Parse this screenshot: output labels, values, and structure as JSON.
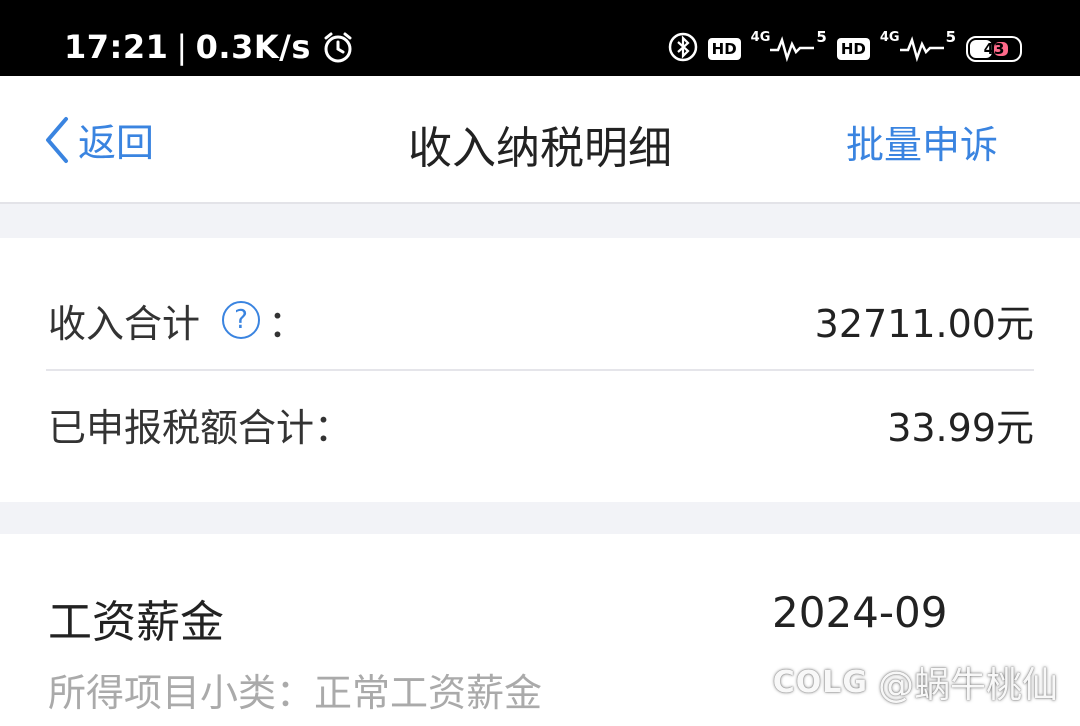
{
  "status_bar": {
    "time": "17:21",
    "speed": "0.3K/s",
    "hd_badge": "HD",
    "network_gen": "4G",
    "signal_num": "5",
    "battery": "43"
  },
  "nav": {
    "back_label": "返回",
    "title": "收入纳税明细",
    "action_label": "批量申诉"
  },
  "summary": {
    "income_total_label": "收入合计",
    "income_total_colon": "：",
    "income_total_value": "32711.00元",
    "tax_total_label": "已申报税额合计：",
    "tax_total_value": "33.99元"
  },
  "item": {
    "title": "工资薪金",
    "period": "2024-09",
    "subtitle": "所得项目小类：正常工资薪金"
  },
  "watermark": {
    "logo": "COLG",
    "text": "@蜗牛桃仙"
  }
}
